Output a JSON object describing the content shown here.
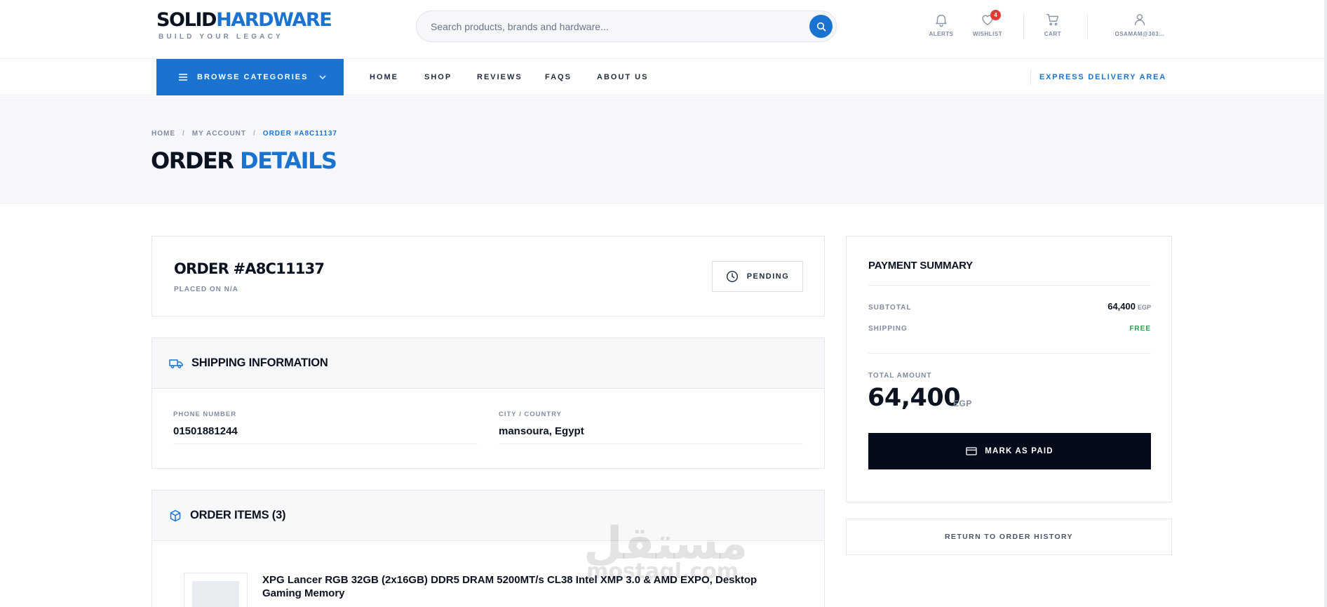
{
  "header": {
    "logo_part1": "SOLID",
    "logo_part2": "HARDWARE",
    "tagline": "BUILD YOUR LEGACY",
    "search_placeholder": "Search products, brands and hardware...",
    "icons": {
      "alerts": "ALERTS",
      "wishlist": "WISHLIST",
      "wishlist_count": "4",
      "cart": "CART",
      "account": "OSAMAM@303..."
    }
  },
  "nav": {
    "browse_label": "BROWSE CATEGORIES",
    "links": [
      "HOME",
      "SHOP",
      "REVIEWS",
      "FAQS",
      "ABOUT US"
    ],
    "express_label": "EXPRESS DELIVERY AREA"
  },
  "hero": {
    "breadcrumb": [
      "HOME",
      "MY ACCOUNT",
      "ORDER #A8C11137"
    ],
    "title_part1": "ORDER",
    "title_part2": "DETAILS"
  },
  "order": {
    "number": "ORDER #A8C11137",
    "placed_on": "PLACED ON N/A",
    "status": "PENDING"
  },
  "shipping": {
    "heading": "SHIPPING INFORMATION",
    "phone_label": "PHONE NUMBER",
    "phone_value": "01501881244",
    "city_label": "CITY / COUNTRY",
    "city_value": "mansoura, Egypt"
  },
  "items": {
    "heading": "ORDER ITEMS (3)",
    "list": [
      {
        "name": "XPG Lancer RGB 32GB (2x16GB) DDR5 DRAM 5200MT/s CL38 Intel XMP 3.0 & AMD EXPO, Desktop Gaming Memory"
      }
    ]
  },
  "payment": {
    "title": "PAYMENT SUMMARY",
    "subtotal_label": "SUBTOTAL",
    "subtotal_value": "64,400",
    "currency": "EGP",
    "shipping_label": "SHIPPING",
    "shipping_value": "FREE",
    "total_label": "TOTAL AMOUNT",
    "total_value": "64,400",
    "pay_button": "MARK AS PAID",
    "return_button": "RETURN TO ORDER HISTORY"
  },
  "watermark": {
    "arabic": "مستقل",
    "latin": "mostaql.com"
  },
  "colors": {
    "accent": "#1a73d1",
    "dark": "#050b1b",
    "success": "#2e9e4f",
    "badge": "#e53935"
  }
}
